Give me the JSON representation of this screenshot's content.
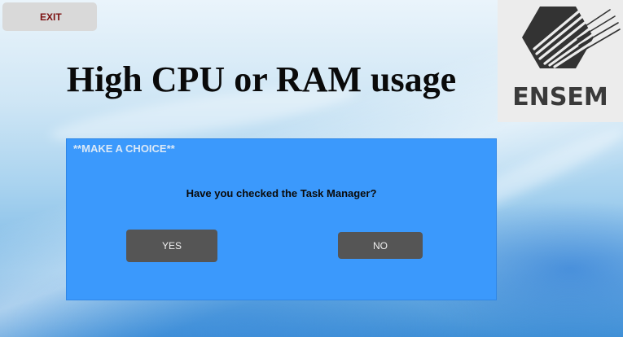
{
  "window": {
    "exit_label": "EXIT",
    "title": "High CPU or RAM usage"
  },
  "logo": {
    "text": "ENSEM",
    "icon": "ensem-logo-icon"
  },
  "dialog": {
    "header": "**MAKE A CHOICE**",
    "question": "Have you checked the Task Manager?",
    "yes_label": "YES",
    "no_label": "NO"
  },
  "colors": {
    "panel": "#3b99fc",
    "button": "#555555",
    "exit_text": "#7b1010",
    "exit_bg": "#d9d9d9"
  }
}
